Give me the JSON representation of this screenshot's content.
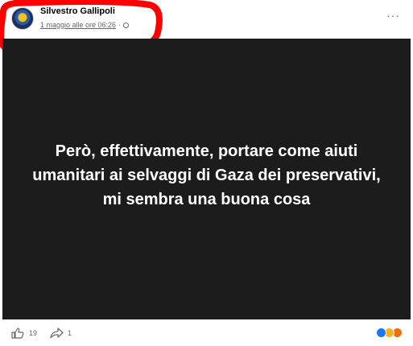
{
  "post": {
    "author": "Silvestro Gallipoli",
    "timestamp": "1 maggio alle ore 06:26",
    "separator": "·",
    "privacy_icon": "globe-icon",
    "more_icon": "more-options-icon",
    "text": "Però, effettivamente, portare come aiuti umanitari ai selvaggi di Gaza dei preservativi, mi sembra una buona cosa"
  },
  "footer": {
    "like_count": "19",
    "share_count": "1",
    "like_icon": "thumbs-up-icon",
    "share_icon": "share-arrow-icon",
    "reaction_icons": [
      "like-reaction-icon",
      "haha-reaction-icon",
      "angry-reaction-icon"
    ]
  },
  "colors": {
    "image_background": "#1c1c1c",
    "annotation": "#ff0000",
    "meta_text": "#65676b",
    "like_blue": "#1877f2"
  }
}
